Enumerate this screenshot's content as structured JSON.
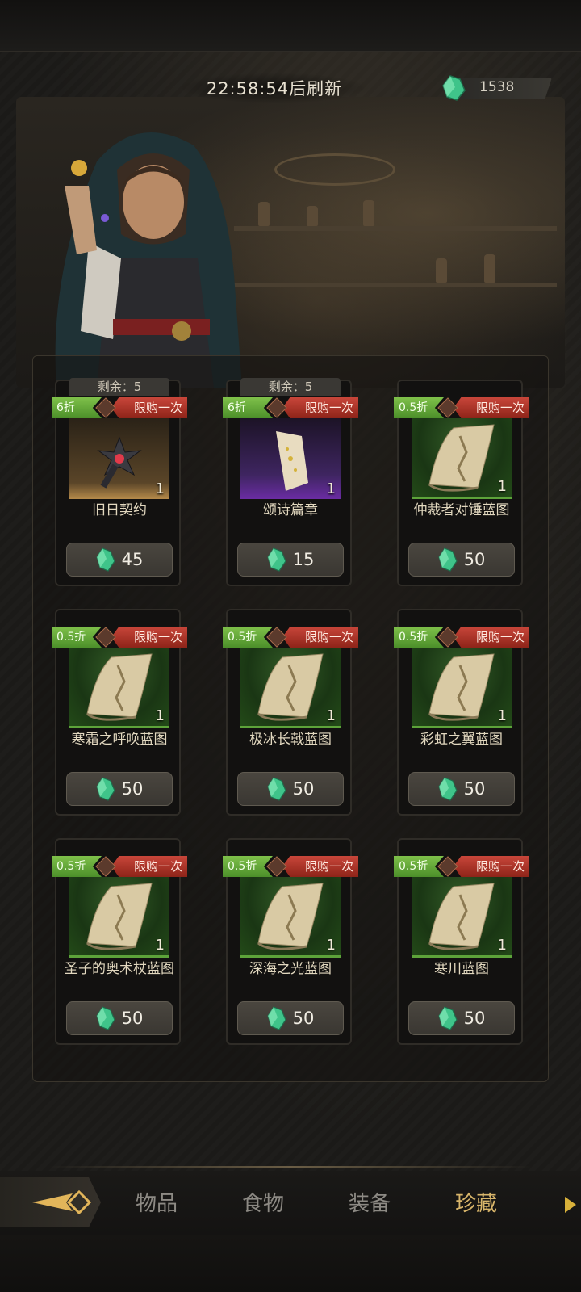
{
  "header": {
    "refresh_timer": "22:58:54后刷新",
    "currency_amount": "1538",
    "currency_icon": "green-crystal-icon"
  },
  "shop_items": [
    {
      "remaining": "剩余：5",
      "discount": "6折",
      "limit": "限购一次",
      "thumb": "brown",
      "icon": "spiked-mace-icon",
      "qty": "1",
      "name": "旧日契约",
      "price": "45"
    },
    {
      "remaining": "剩余：5",
      "discount": "6折",
      "limit": "限购一次",
      "thumb": "purple",
      "icon": "scroll-page-icon",
      "qty": "1",
      "name": "颂诗篇章",
      "price": "15"
    },
    {
      "discount": "0.5折",
      "limit": "限购一次",
      "thumb": "green",
      "icon": "blueprint-scroll-icon",
      "qty": "1",
      "name": "仲裁者对锤蓝图",
      "price": "50"
    },
    {
      "discount": "0.5折",
      "limit": "限购一次",
      "thumb": "green",
      "icon": "blueprint-scroll-icon",
      "qty": "1",
      "name": "寒霜之呼唤蓝图",
      "price": "50"
    },
    {
      "discount": "0.5折",
      "limit": "限购一次",
      "thumb": "green",
      "icon": "blueprint-scroll-icon",
      "qty": "1",
      "name": "极冰长戟蓝图",
      "price": "50"
    },
    {
      "discount": "0.5折",
      "limit": "限购一次",
      "thumb": "green",
      "icon": "blueprint-scroll-icon",
      "qty": "1",
      "name": "彩虹之翼蓝图",
      "price": "50"
    },
    {
      "discount": "0.5折",
      "limit": "限购一次",
      "thumb": "green",
      "icon": "blueprint-scroll-icon",
      "qty": "1",
      "name": "圣子的奥术杖蓝图",
      "price": "50"
    },
    {
      "discount": "0.5折",
      "limit": "限购一次",
      "thumb": "green",
      "icon": "blueprint-scroll-icon",
      "qty": "1",
      "name": "深海之光蓝图",
      "price": "50"
    },
    {
      "discount": "0.5折",
      "limit": "限购一次",
      "thumb": "green",
      "icon": "blueprint-scroll-icon",
      "qty": "1",
      "name": "寒川蓝图",
      "price": "50"
    }
  ],
  "nav": {
    "tabs": [
      {
        "label": "物品",
        "active": false
      },
      {
        "label": "食物",
        "active": false
      },
      {
        "label": "装备",
        "active": false
      },
      {
        "label": "珍藏",
        "active": true
      }
    ]
  },
  "colors": {
    "discount_tag": "#6fb43c",
    "limit_tag": "#b8382b",
    "active_tab": "#d8b56a",
    "inactive_tab": "#8d8a84"
  }
}
